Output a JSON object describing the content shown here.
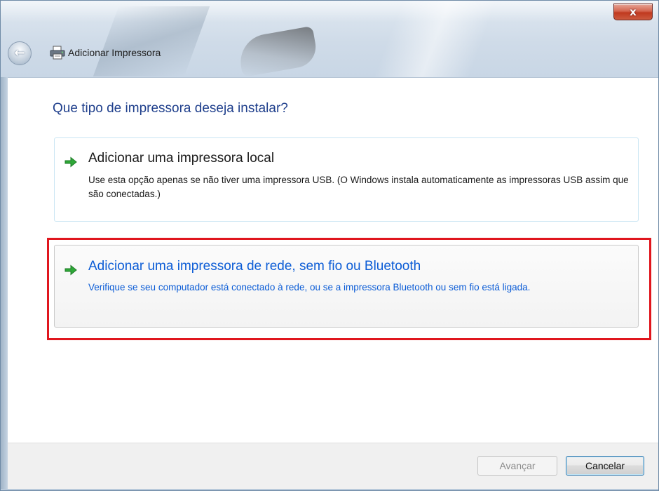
{
  "window": {
    "title": "Adicionar Impressora",
    "close_label": "x",
    "back_label": "←"
  },
  "main": {
    "heading": "Que tipo de impressora deseja instalar?",
    "options": [
      {
        "title": "Adicionar uma impressora local",
        "description": "Use esta opção apenas se não tiver uma impressora USB. (O Windows instala automaticamente as impressoras USB assim que são conectadas.)"
      },
      {
        "title": "Adicionar uma impressora de rede, sem fio ou Bluetooth",
        "description": "Verifique se seu computador está conectado à rede, ou se a impressora Bluetooth ou sem fio está ligada."
      }
    ]
  },
  "footer": {
    "next_label": "Avançar",
    "cancel_label": "Cancelar"
  },
  "colors": {
    "heading": "#1f3f8c",
    "link_blue": "#0b5cd6",
    "arrow_green": "#2fa838",
    "highlight_red": "#e0161e"
  },
  "icons": {
    "back": "back-arrow-icon",
    "printer": "printer-icon",
    "option_arrow": "green-arrow-icon",
    "close": "close-icon"
  }
}
